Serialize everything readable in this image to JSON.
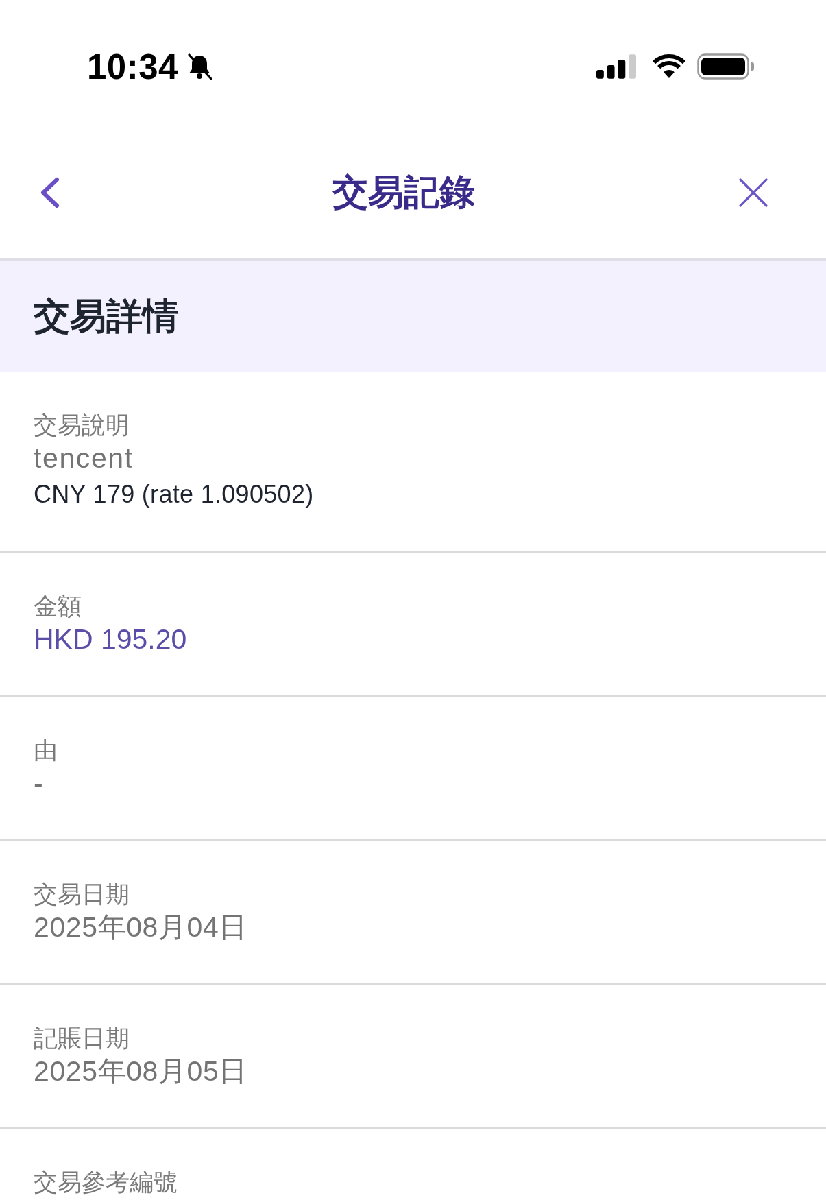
{
  "status_bar": {
    "time": "10:34"
  },
  "nav": {
    "title": "交易記錄"
  },
  "section": {
    "title": "交易詳情"
  },
  "fields": [
    {
      "label": "交易說明",
      "kind": "text",
      "value": "tencent",
      "note": "CNY 179 (rate 1.090502)"
    },
    {
      "label": "金額",
      "kind": "amount",
      "value": "HKD 195.20"
    },
    {
      "label": "由",
      "kind": "text",
      "value": "-"
    },
    {
      "label": "交易日期",
      "kind": "text",
      "value": "2025年08月04日"
    },
    {
      "label": "記賬日期",
      "kind": "text",
      "value": "2025年08月05日"
    },
    {
      "label": "交易參考編號"
    }
  ]
}
